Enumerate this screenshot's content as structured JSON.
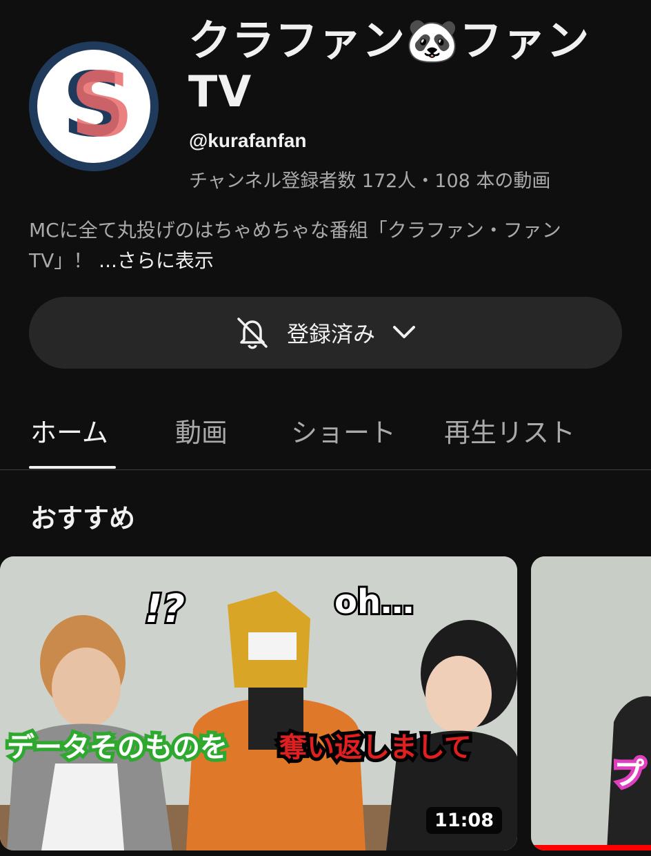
{
  "channel": {
    "title": "クラファン🐼ファン TV",
    "handle": "@kurafanfan",
    "stats": "チャンネル登録者数 172人・108 本の動画",
    "description": "MCに全て丸投げのはちゃめちゃな番組「クラファン・ファン TV」！",
    "more_label": "...さらに表示",
    "avatar_letter": "S"
  },
  "subscribe": {
    "label": "登録済み"
  },
  "tabs": [
    {
      "label": "ホーム",
      "active": true
    },
    {
      "label": "動画",
      "active": false
    },
    {
      "label": "ショート",
      "active": false
    },
    {
      "label": "再生リスト",
      "active": false
    }
  ],
  "section": {
    "title": "おすすめ"
  },
  "videos": [
    {
      "duration": "11:08",
      "caption_left": "データそのものを",
      "caption_right": "奪い返しまして",
      "overlay_a": "!?",
      "overlay_b": "oh…"
    },
    {
      "caption": "プ"
    }
  ],
  "colors": {
    "background": "#0f0f0f",
    "button": "#272727",
    "secondary_text": "#aaaaaa",
    "accent_red": "#ff0000"
  }
}
